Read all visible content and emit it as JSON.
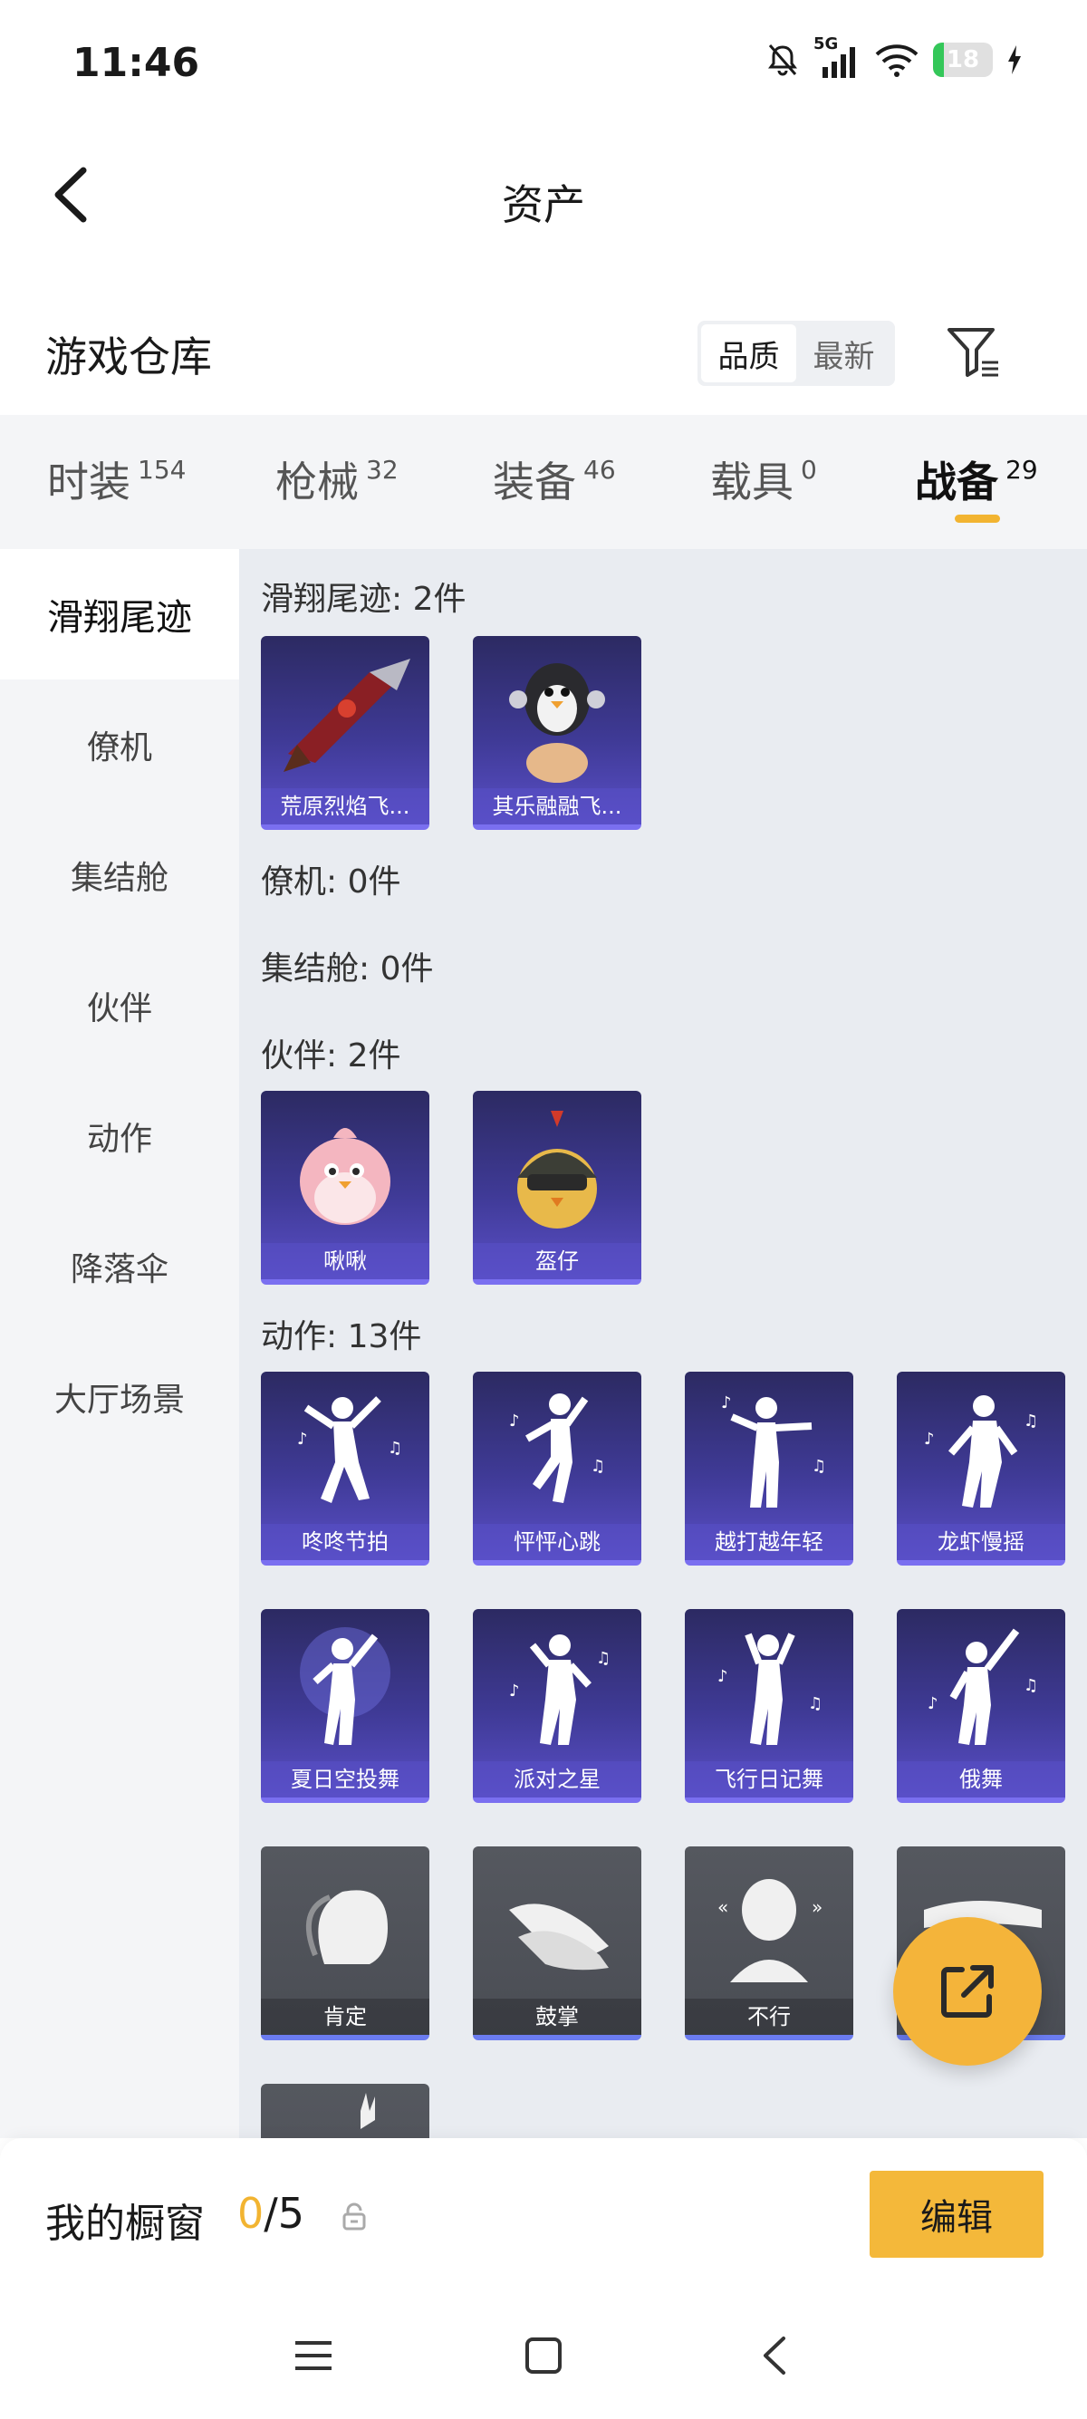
{
  "status_bar": {
    "time": "11:46",
    "network": "5G",
    "battery": "18",
    "battery_level": 0.18,
    "battery_color": "#34c759"
  },
  "header": {
    "title": "资产",
    "back_icon": "chevron-left-icon"
  },
  "warehouse": {
    "title": "游戏仓库",
    "sort_options": [
      "品质",
      "最新"
    ],
    "sort_selected": "品质",
    "filter_icon": "filter-icon"
  },
  "tabs": [
    {
      "label": "时装",
      "count": "154"
    },
    {
      "label": "枪械",
      "count": "32"
    },
    {
      "label": "装备",
      "count": "46"
    },
    {
      "label": "载具",
      "count": "0"
    },
    {
      "label": "战备",
      "count": "29",
      "active": true
    }
  ],
  "sidebar": {
    "items": [
      "滑翔尾迹",
      "僚机",
      "集结舱",
      "伙伴",
      "动作",
      "降落伞",
      "大厅场景"
    ],
    "active": "滑翔尾迹"
  },
  "sections": {
    "glide": {
      "title": "滑翔尾迹: 2件",
      "items": [
        "荒原烈焰飞...",
        "其乐融融飞..."
      ]
    },
    "wingman": {
      "title": "僚机: 0件"
    },
    "capsule": {
      "title": "集结舱: 0件"
    },
    "partner": {
      "title": "伙伴: 2件",
      "items": [
        "啾啾",
        "盔仔"
      ]
    },
    "emote": {
      "title": "动作: 13件",
      "items": [
        "咚咚节拍",
        "怦怦心跳",
        "越打越年轻",
        "龙虾慢摇",
        "夏日空投舞",
        "派对之星",
        "飞行日记舞",
        "俄舞",
        "肯定",
        "鼓掌",
        "不行",
        ""
      ]
    }
  },
  "fab": {
    "icon": "share-external-icon"
  },
  "showcase": {
    "title": "我的橱窗",
    "current": "0",
    "total": "/5",
    "edit_label": "编辑"
  },
  "colors": {
    "accent": "#f2b431",
    "rare_card": "#3f3a96",
    "common_card": "#4a4d54"
  }
}
